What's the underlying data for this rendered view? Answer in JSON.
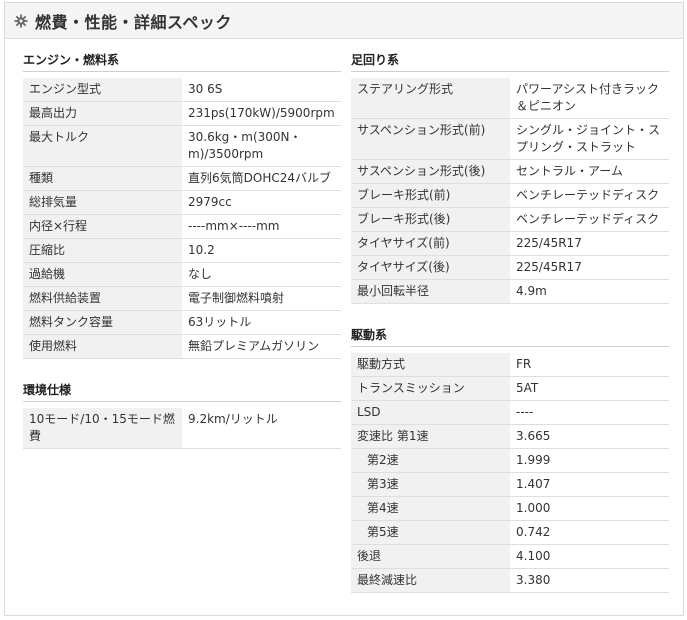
{
  "header": {
    "title": "燃費・性能・詳細スペック",
    "icon": "gear-icon"
  },
  "engine": {
    "title": "エンジン・燃料系",
    "rows": [
      {
        "label": "エンジン型式",
        "value": "30 6S"
      },
      {
        "label": "最高出力",
        "value": "231ps(170kW)/5900rpm"
      },
      {
        "label": "最大トルク",
        "value": "30.6kg・m(300N・m)/3500rpm"
      },
      {
        "label": "種類",
        "value": "直列6気筒DOHC24バルブ"
      },
      {
        "label": "総排気量",
        "value": "2979cc"
      },
      {
        "label": "内径×行程",
        "value": "----mm×----mm"
      },
      {
        "label": "圧縮比",
        "value": "10.2"
      },
      {
        "label": "過給機",
        "value": "なし"
      },
      {
        "label": "燃料供給装置",
        "value": "電子制御燃料噴射"
      },
      {
        "label": "燃料タンク容量",
        "value": "63リットル"
      },
      {
        "label": "使用燃料",
        "value": "無鉛プレミアムガソリン"
      }
    ]
  },
  "environment": {
    "title": "環境仕様",
    "rows": [
      {
        "label": "10モード/10・15モード燃費",
        "value": "9.2km/リットル"
      }
    ]
  },
  "suspension": {
    "title": "足回り系",
    "rows": [
      {
        "label": "ステアリング形式",
        "value": "パワーアシスト付きラック＆ピニオン"
      },
      {
        "label": "サスペンション形式(前)",
        "value": "シングル・ジョイント・スプリング・ストラット"
      },
      {
        "label": "サスペンション形式(後)",
        "value": "セントラル・アーム"
      },
      {
        "label": "ブレーキ形式(前)",
        "value": "ベンチレーテッドディスク"
      },
      {
        "label": "ブレーキ形式(後)",
        "value": "ベンチレーテッドディスク"
      },
      {
        "label": "タイヤサイズ(前)",
        "value": "225/45R17"
      },
      {
        "label": "タイヤサイズ(後)",
        "value": "225/45R17"
      },
      {
        "label": "最小回転半径",
        "value": "4.9m"
      }
    ]
  },
  "drivetrain": {
    "title": "駆動系",
    "rows": [
      {
        "label": "駆動方式",
        "value": "FR"
      },
      {
        "label": "トランスミッション",
        "value": "5AT"
      },
      {
        "label": "LSD",
        "value": "----"
      },
      {
        "label": "変速比 第1速",
        "value": "3.665"
      },
      {
        "label": "第2速",
        "value": "1.999"
      },
      {
        "label": "第3速",
        "value": "1.407"
      },
      {
        "label": "第4速",
        "value": "1.000"
      },
      {
        "label": "第5速",
        "value": "0.742"
      },
      {
        "label": "後退",
        "value": "4.100"
      },
      {
        "label": "最終減速比",
        "value": "3.380"
      }
    ]
  }
}
